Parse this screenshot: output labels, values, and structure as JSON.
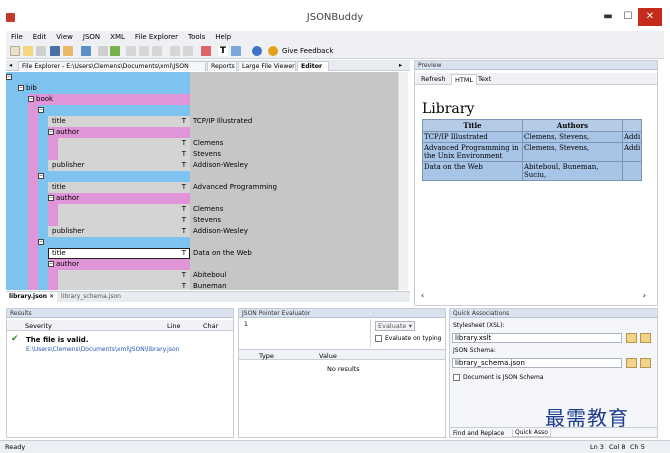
{
  "window": {
    "title": "JSONBuddy",
    "controls": [
      "▬",
      "☐",
      "✕"
    ]
  },
  "menu": [
    "File",
    "Edit",
    "View",
    "JSON",
    "XML",
    "File Explorer",
    "Tools",
    "Help"
  ],
  "toolbar": {
    "feedback_label": "Give Feedback"
  },
  "editor_tabs": {
    "file_explorer": "File Explorer - E:\\Users\\Clemens\\Documents\\xml\\JSON",
    "reports": "Reports",
    "large_file_viewer": "Large File Viewer",
    "editor": "Editor"
  },
  "tree": {
    "bib": "bib",
    "book": "book",
    "rows": [
      {
        "key": "title",
        "type": "T",
        "value": "TCP/IP Illustrated",
        "kind": "key"
      },
      {
        "key": "author",
        "type": "",
        "value": "",
        "kind": "obj"
      },
      {
        "key": "",
        "type": "T",
        "value": "Clemens",
        "kind": "item"
      },
      {
        "key": "",
        "type": "T",
        "value": "Stevens",
        "kind": "item"
      },
      {
        "key": "publisher",
        "type": "T",
        "value": "Addison-Wesley",
        "kind": "key"
      },
      {
        "key": "",
        "type": "",
        "value": "",
        "kind": "arr"
      },
      {
        "key": "title",
        "type": "T",
        "value": "Advanced Programming",
        "kind": "key"
      },
      {
        "key": "author",
        "type": "",
        "value": "",
        "kind": "obj"
      },
      {
        "key": "",
        "type": "T",
        "value": "Clemens",
        "kind": "item"
      },
      {
        "key": "",
        "type": "T",
        "value": "Stevens",
        "kind": "item"
      },
      {
        "key": "publisher",
        "type": "T",
        "value": "Addison-Wesley",
        "kind": "key"
      },
      {
        "key": "",
        "type": "",
        "value": "",
        "kind": "arr"
      },
      {
        "key": "title",
        "type": "T",
        "value": "Data on the Web",
        "kind": "key-selected"
      },
      {
        "key": "author",
        "type": "",
        "value": "",
        "kind": "obj"
      },
      {
        "key": "",
        "type": "T",
        "value": "Abiteboul",
        "kind": "item"
      },
      {
        "key": "",
        "type": "T",
        "value": "Buneman",
        "kind": "item"
      }
    ]
  },
  "file_tabs": [
    "library.json",
    "library_schema.json"
  ],
  "preview": {
    "header": "Preview",
    "tabs": [
      "Refresh",
      "HTML",
      "Text"
    ],
    "heading": "Library",
    "columns": [
      "Title",
      "Authors",
      ""
    ],
    "rows": [
      [
        "TCP/IP Illustrated",
        "Clemens, Stevens,",
        "Addi"
      ],
      [
        "Advanced Programming in the Unix Environment",
        "Clemens, Stevens,",
        "Addi"
      ],
      [
        "Data on the Web",
        "Abiteboul, Buneman, Suciu,",
        ""
      ]
    ]
  },
  "results": {
    "header": "Results",
    "columns": [
      "Severity",
      "Line",
      "Char"
    ],
    "message": "The file is valid.",
    "path": "E:\\Users\\Clemens\\Documents\\xml\\JSON\\library.json"
  },
  "pointer": {
    "header": "JSON Pointer Evaluator",
    "line_number": "1",
    "evaluate_label": "Evaluate",
    "evaluate_typing": "Evaluate on typing",
    "columns": [
      "Type",
      "Value"
    ],
    "empty": "No results"
  },
  "quick": {
    "header": "Quick Associations",
    "stylesheet_label": "Stylesheet (XSL):",
    "stylesheet_value": "library.xslt",
    "schema_label": "JSON Schema:",
    "schema_value": "library_schema.json",
    "is_schema_label": "Document is JSON Schema",
    "bottom_tabs": [
      "Find and Replace",
      "Quick Asso"
    ]
  },
  "status": {
    "left": "Ready",
    "line": "Ln 3",
    "col": "Col 8",
    "ch": "Ch 5"
  },
  "watermark": "最需教育"
}
